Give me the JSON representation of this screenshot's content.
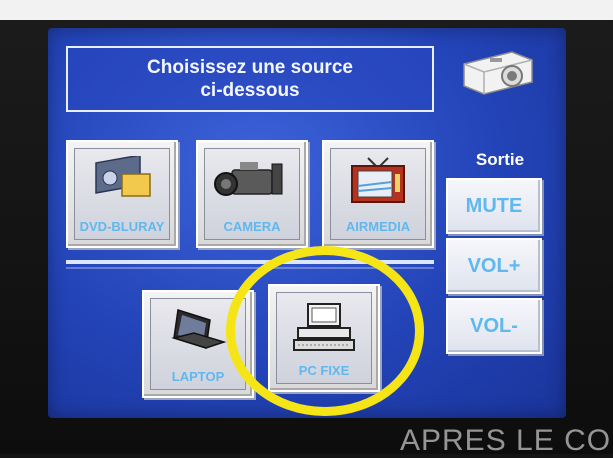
{
  "header": {
    "title_line1": "Choisissez une source",
    "title_line2": "ci-dessous"
  },
  "output": {
    "label": "Sortie",
    "icon": "projector-icon"
  },
  "sources": [
    {
      "label": "DVD-BLURAY",
      "icon": "disc-player-icon"
    },
    {
      "label": "CAMERA",
      "icon": "camcorder-icon"
    },
    {
      "label": "AIRMEDIA",
      "icon": "tv-icon"
    },
    {
      "label": "LAPTOP",
      "icon": "laptop-icon"
    },
    {
      "label": "PC FIXE",
      "icon": "desktop-pc-icon"
    }
  ],
  "audio": {
    "mute": "MUTE",
    "vol_up": "VOL+",
    "vol_down": "VOL-"
  },
  "annotation": {
    "highlight_color": "#f5e517"
  },
  "colors": {
    "screen": "#2344b8",
    "button_text": "#5fb8ee"
  },
  "caption": "APRES LE CO"
}
